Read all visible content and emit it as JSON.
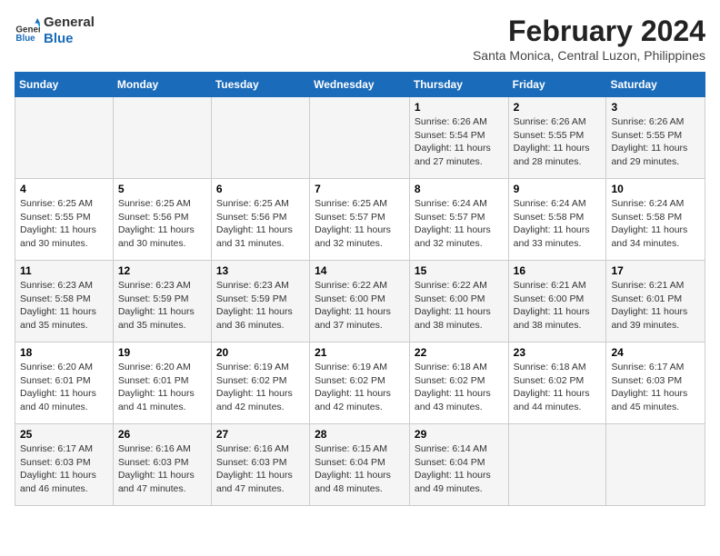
{
  "logo": {
    "line1": "General",
    "line2": "Blue"
  },
  "title": "February 2024",
  "subtitle": "Santa Monica, Central Luzon, Philippines",
  "days_of_week": [
    "Sunday",
    "Monday",
    "Tuesday",
    "Wednesday",
    "Thursday",
    "Friday",
    "Saturday"
  ],
  "weeks": [
    [
      {
        "day": "",
        "info": ""
      },
      {
        "day": "",
        "info": ""
      },
      {
        "day": "",
        "info": ""
      },
      {
        "day": "",
        "info": ""
      },
      {
        "day": "1",
        "info": "Sunrise: 6:26 AM\nSunset: 5:54 PM\nDaylight: 11 hours and 27 minutes."
      },
      {
        "day": "2",
        "info": "Sunrise: 6:26 AM\nSunset: 5:55 PM\nDaylight: 11 hours and 28 minutes."
      },
      {
        "day": "3",
        "info": "Sunrise: 6:26 AM\nSunset: 5:55 PM\nDaylight: 11 hours and 29 minutes."
      }
    ],
    [
      {
        "day": "4",
        "info": "Sunrise: 6:25 AM\nSunset: 5:55 PM\nDaylight: 11 hours and 30 minutes."
      },
      {
        "day": "5",
        "info": "Sunrise: 6:25 AM\nSunset: 5:56 PM\nDaylight: 11 hours and 30 minutes."
      },
      {
        "day": "6",
        "info": "Sunrise: 6:25 AM\nSunset: 5:56 PM\nDaylight: 11 hours and 31 minutes."
      },
      {
        "day": "7",
        "info": "Sunrise: 6:25 AM\nSunset: 5:57 PM\nDaylight: 11 hours and 32 minutes."
      },
      {
        "day": "8",
        "info": "Sunrise: 6:24 AM\nSunset: 5:57 PM\nDaylight: 11 hours and 32 minutes."
      },
      {
        "day": "9",
        "info": "Sunrise: 6:24 AM\nSunset: 5:58 PM\nDaylight: 11 hours and 33 minutes."
      },
      {
        "day": "10",
        "info": "Sunrise: 6:24 AM\nSunset: 5:58 PM\nDaylight: 11 hours and 34 minutes."
      }
    ],
    [
      {
        "day": "11",
        "info": "Sunrise: 6:23 AM\nSunset: 5:58 PM\nDaylight: 11 hours and 35 minutes."
      },
      {
        "day": "12",
        "info": "Sunrise: 6:23 AM\nSunset: 5:59 PM\nDaylight: 11 hours and 35 minutes."
      },
      {
        "day": "13",
        "info": "Sunrise: 6:23 AM\nSunset: 5:59 PM\nDaylight: 11 hours and 36 minutes."
      },
      {
        "day": "14",
        "info": "Sunrise: 6:22 AM\nSunset: 6:00 PM\nDaylight: 11 hours and 37 minutes."
      },
      {
        "day": "15",
        "info": "Sunrise: 6:22 AM\nSunset: 6:00 PM\nDaylight: 11 hours and 38 minutes."
      },
      {
        "day": "16",
        "info": "Sunrise: 6:21 AM\nSunset: 6:00 PM\nDaylight: 11 hours and 38 minutes."
      },
      {
        "day": "17",
        "info": "Sunrise: 6:21 AM\nSunset: 6:01 PM\nDaylight: 11 hours and 39 minutes."
      }
    ],
    [
      {
        "day": "18",
        "info": "Sunrise: 6:20 AM\nSunset: 6:01 PM\nDaylight: 11 hours and 40 minutes."
      },
      {
        "day": "19",
        "info": "Sunrise: 6:20 AM\nSunset: 6:01 PM\nDaylight: 11 hours and 41 minutes."
      },
      {
        "day": "20",
        "info": "Sunrise: 6:19 AM\nSunset: 6:02 PM\nDaylight: 11 hours and 42 minutes."
      },
      {
        "day": "21",
        "info": "Sunrise: 6:19 AM\nSunset: 6:02 PM\nDaylight: 11 hours and 42 minutes."
      },
      {
        "day": "22",
        "info": "Sunrise: 6:18 AM\nSunset: 6:02 PM\nDaylight: 11 hours and 43 minutes."
      },
      {
        "day": "23",
        "info": "Sunrise: 6:18 AM\nSunset: 6:02 PM\nDaylight: 11 hours and 44 minutes."
      },
      {
        "day": "24",
        "info": "Sunrise: 6:17 AM\nSunset: 6:03 PM\nDaylight: 11 hours and 45 minutes."
      }
    ],
    [
      {
        "day": "25",
        "info": "Sunrise: 6:17 AM\nSunset: 6:03 PM\nDaylight: 11 hours and 46 minutes."
      },
      {
        "day": "26",
        "info": "Sunrise: 6:16 AM\nSunset: 6:03 PM\nDaylight: 11 hours and 47 minutes."
      },
      {
        "day": "27",
        "info": "Sunrise: 6:16 AM\nSunset: 6:03 PM\nDaylight: 11 hours and 47 minutes."
      },
      {
        "day": "28",
        "info": "Sunrise: 6:15 AM\nSunset: 6:04 PM\nDaylight: 11 hours and 48 minutes."
      },
      {
        "day": "29",
        "info": "Sunrise: 6:14 AM\nSunset: 6:04 PM\nDaylight: 11 hours and 49 minutes."
      },
      {
        "day": "",
        "info": ""
      },
      {
        "day": "",
        "info": ""
      }
    ]
  ]
}
